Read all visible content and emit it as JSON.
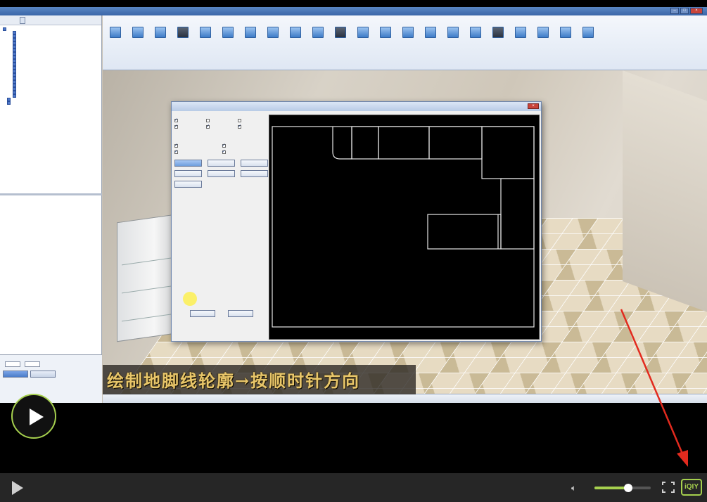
{
  "app": {
    "window_title": "",
    "left_panel": {
      "tab_label": "",
      "button_label": "",
      "tree_items": [
        "",
        "",
        "",
        "",
        "",
        "",
        "",
        "",
        "",
        "",
        "",
        "",
        "",
        "",
        "",
        "",
        "",
        "",
        "",
        "",
        "",
        ""
      ],
      "props_title": "",
      "props_field1_label": "",
      "props_field2_label": "",
      "props_btn1": "",
      "props_btn2": "",
      "props_radio1": "",
      "props_radio2": ""
    },
    "ribbon": {
      "menus": [
        "",
        "",
        "",
        "",
        "",
        "",
        "",
        "",
        "",
        "",
        ""
      ],
      "tools": [
        "",
        "",
        "",
        "",
        "",
        "",
        "",
        "",
        "",
        "",
        "",
        "",
        "",
        "",
        "",
        "",
        "",
        "",
        "",
        "",
        "",
        ""
      ],
      "subbar": [
        "",
        "",
        "",
        "",
        "",
        "",
        "",
        "",
        "",
        "",
        "",
        "",
        "",
        "",
        "",
        "",
        "",
        "",
        ""
      ]
    },
    "status_text": ""
  },
  "dialog": {
    "title": "",
    "group1_title": "",
    "group1_checks": [
      {
        "label": "",
        "checked": true
      },
      {
        "label": "",
        "checked": false
      },
      {
        "label": "",
        "checked": false
      },
      {
        "label": "",
        "checked": true
      },
      {
        "label": "",
        "checked": true
      },
      {
        "label": "",
        "checked": true
      }
    ],
    "group2_title": "",
    "group2_checks": [
      {
        "label": "",
        "checked": true
      },
      {
        "label": "",
        "checked": true
      },
      {
        "label": "",
        "checked": true
      },
      {
        "label": "",
        "checked": true
      }
    ],
    "group3_title": "",
    "op_buttons": [
      "",
      "",
      "",
      "",
      "",
      "",
      ""
    ],
    "tip": "",
    "ok_label": "",
    "cancel_label": ""
  },
  "subtitle": "绘制地脚线轮廓→按顺时针方向",
  "player": {
    "volume_fraction": 0.6,
    "brand": "iQIY",
    "accent_color": "#a6d04e",
    "icons": [
      "play-icon",
      "volume-icon",
      "fullscreen-icon",
      "iqiyi-logo"
    ]
  }
}
